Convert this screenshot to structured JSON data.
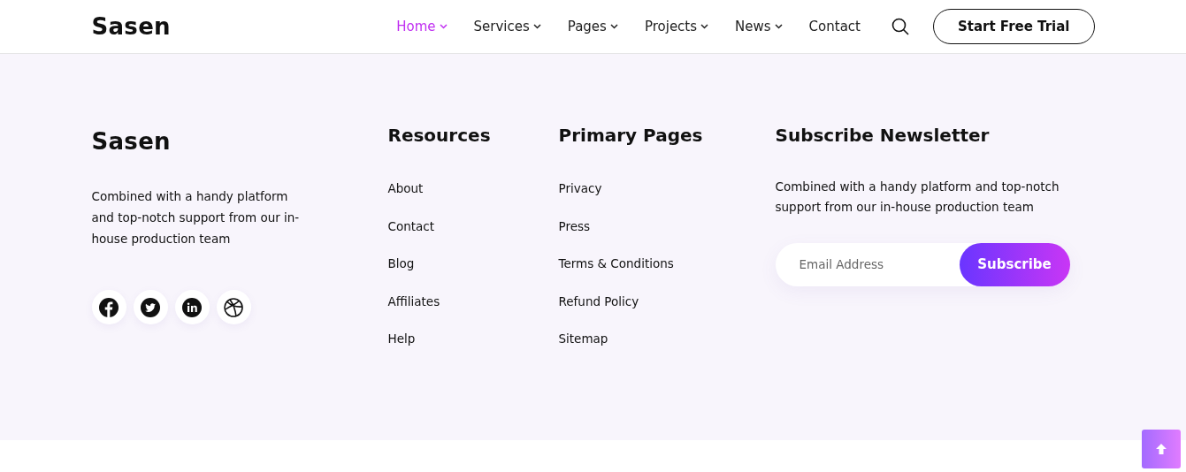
{
  "header": {
    "logo": "Sasen",
    "nav": [
      {
        "label": "Home",
        "selected": true,
        "dropdown": true
      },
      {
        "label": "Services",
        "selected": false,
        "dropdown": true
      },
      {
        "label": "Pages",
        "selected": false,
        "dropdown": true
      },
      {
        "label": "Projects",
        "selected": false,
        "dropdown": true
      },
      {
        "label": "News",
        "selected": false,
        "dropdown": true
      },
      {
        "label": "Contact",
        "selected": false,
        "dropdown": false
      }
    ],
    "cta": "Start Free Trial"
  },
  "footer": {
    "brand": {
      "logo": "Sasen",
      "text": "Combined with a handy platform and top-notch support from our in-house production team"
    },
    "columns": [
      {
        "title": "Resources",
        "links": [
          "About",
          "Contact",
          "Blog",
          "Affiliates",
          "Help"
        ]
      },
      {
        "title": "Primary Pages",
        "links": [
          "Privacy",
          "Press",
          "Terms & Conditions",
          "Refund Policy",
          "Sitemap"
        ]
      }
    ],
    "newsletter": {
      "title": "Subscribe Newsletter",
      "text": "Combined with a handy platform and top-notch support from our in-house production team",
      "placeholder": "Email Address",
      "button": "Subscribe"
    }
  }
}
